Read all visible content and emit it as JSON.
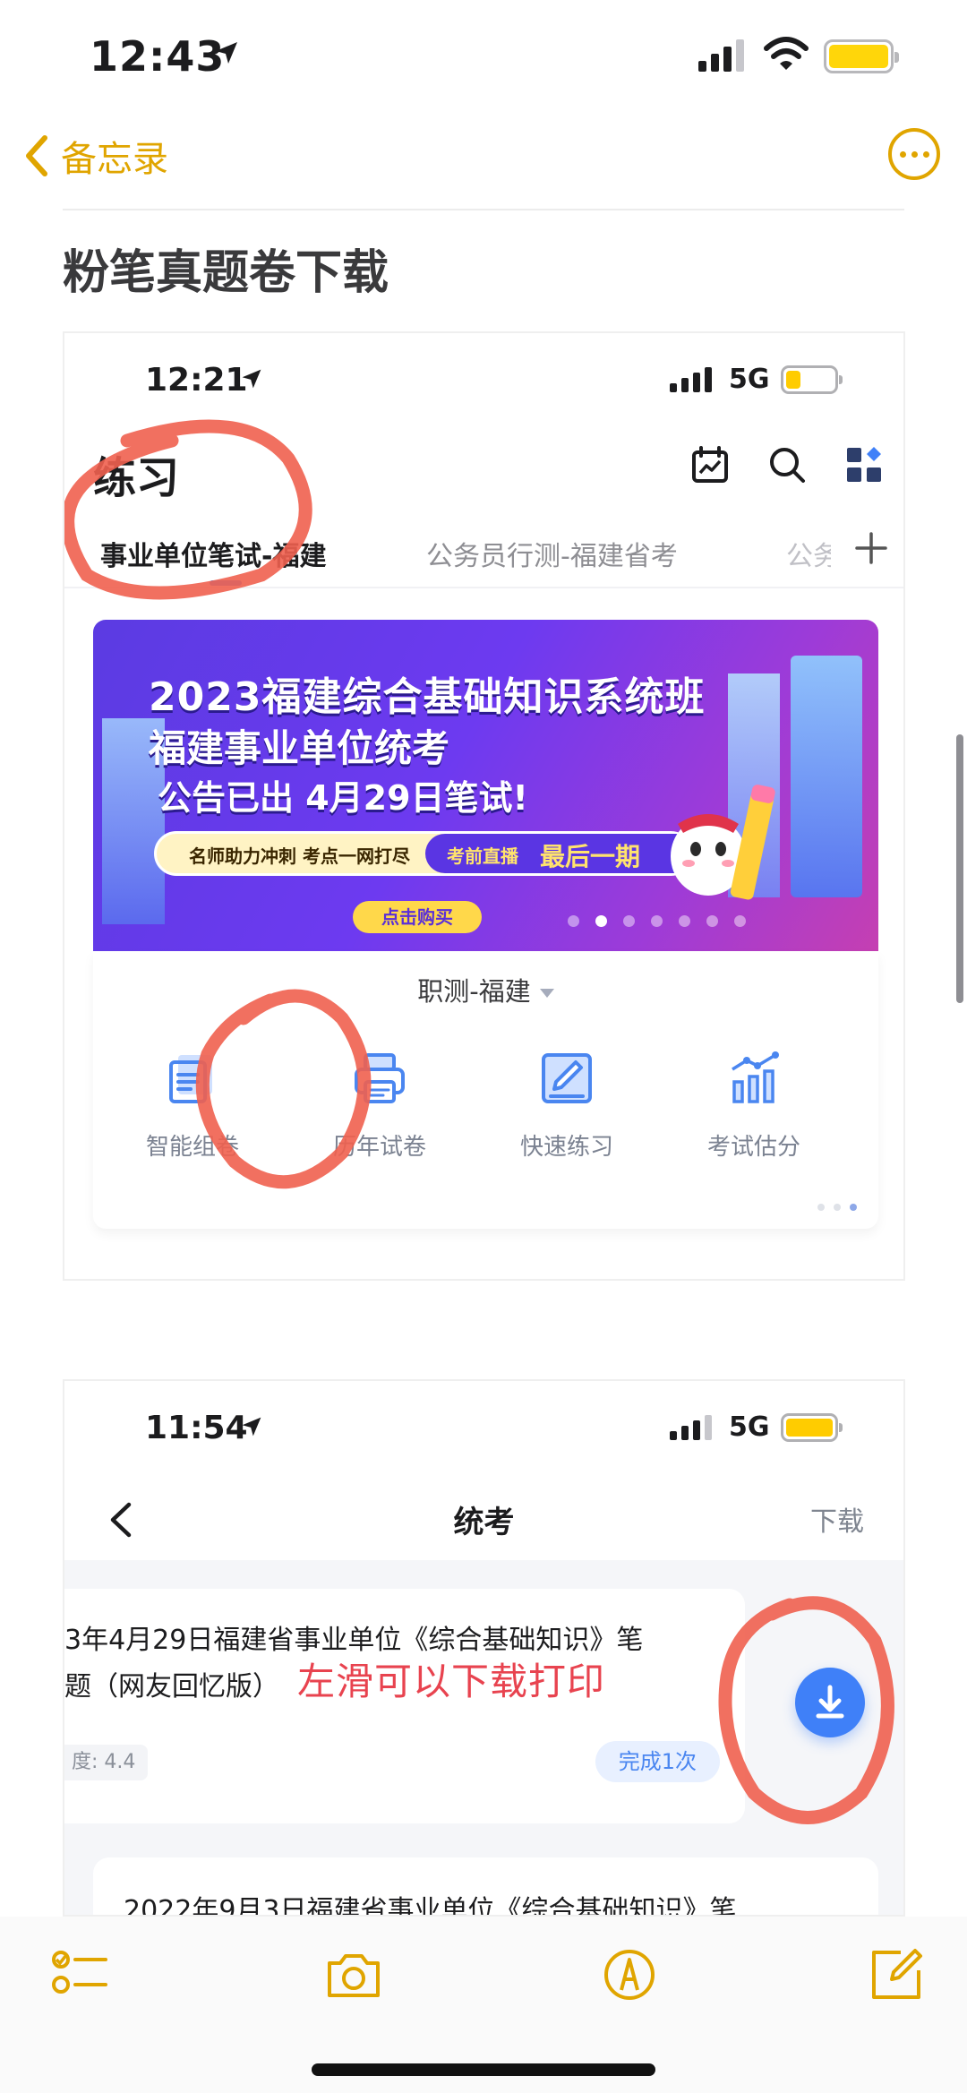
{
  "status_bar": {
    "time": "12:43"
  },
  "nav": {
    "back_label": "备忘录"
  },
  "note": {
    "title": "粉笔真题卷下载"
  },
  "shot1": {
    "time": "12:21",
    "network": "5G",
    "page_title": "练习",
    "tabs": [
      "事业单位笔试-福建",
      "公务员行测-福建省考",
      "公务员"
    ],
    "banner": {
      "line1": "2023福建综合基础知识系统班",
      "line2": "福建事业单位统考",
      "line3": "公告已出 4月29日笔试!",
      "pill_left": "名师助力冲刺  考点一网打尽",
      "pill_mid": "考前直播",
      "pill_right": "最后一期",
      "buy": "点击购买"
    },
    "subject": "职测-福建",
    "tools": [
      "智能组卷",
      "历年试卷",
      "快速练习",
      "考试估分"
    ]
  },
  "shot2": {
    "time": "11:54",
    "network": "5G",
    "title": "统考",
    "download": "下载",
    "card1_line1": "3年4月29日福建省事业单位《综合基础知识》笔",
    "card1_line2": "题（网友回忆版）",
    "card1_chip": "度: 4.4",
    "card1_done": "完成1次",
    "card2_line1": "2022年9月3日福建省事业单位《综合基础知识》笔",
    "annotation": "左滑可以下载打印"
  },
  "colors": {
    "notes_accent": "#e0a500",
    "app_blue": "#3f80f8",
    "marker_red": "#f0604f"
  }
}
